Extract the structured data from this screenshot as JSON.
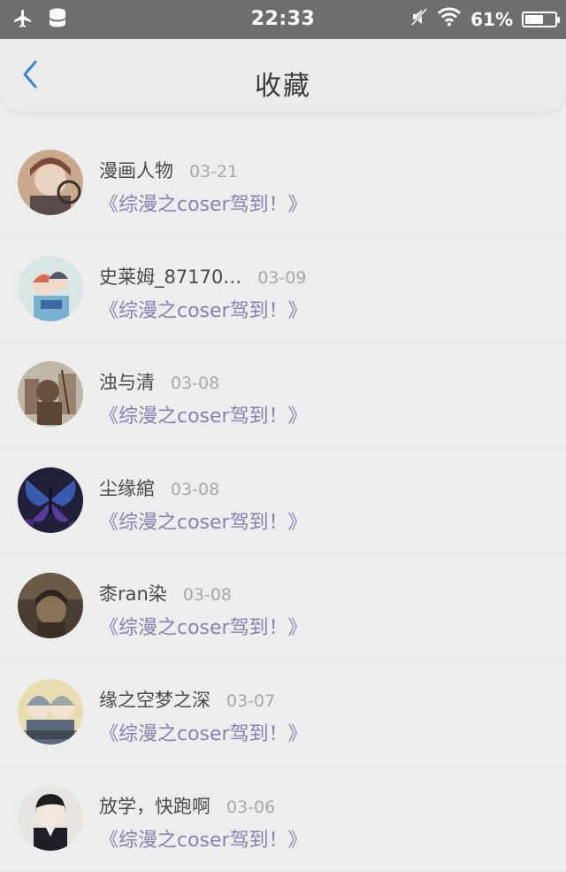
{
  "status_bar": {
    "time": "22:33",
    "battery_text": "61%",
    "battery_level": 0.61,
    "icons": [
      "airplane-icon",
      "storage-icon",
      "mute-icon",
      "wifi-icon",
      "battery-icon"
    ]
  },
  "header": {
    "title": "收藏",
    "back_icon": "chevron-left-icon"
  },
  "colors": {
    "accent_link": "#8882b2",
    "back_arrow": "#3d86c6",
    "status_bar_bg": "#6e6e6e"
  },
  "items": [
    {
      "name": "漫画人物",
      "date": "03-21",
      "work": "《综漫之coser驾到！》"
    },
    {
      "name": "史莱姆_87170…",
      "date": "03-09",
      "work": "《综漫之coser驾到！》"
    },
    {
      "name": "浊与清",
      "date": "03-08",
      "work": "《综漫之coser驾到！》"
    },
    {
      "name": "尘缘綰",
      "date": "03-08",
      "work": "《综漫之coser驾到！》"
    },
    {
      "name": "桼ran染",
      "date": "03-08",
      "work": "《综漫之coser驾到！》"
    },
    {
      "name": "缘之空梦之深",
      "date": "03-07",
      "work": "《综漫之coser驾到！》"
    },
    {
      "name": "放学，快跑啊",
      "date": "03-06",
      "work": "《综漫之coser驾到！》"
    }
  ]
}
